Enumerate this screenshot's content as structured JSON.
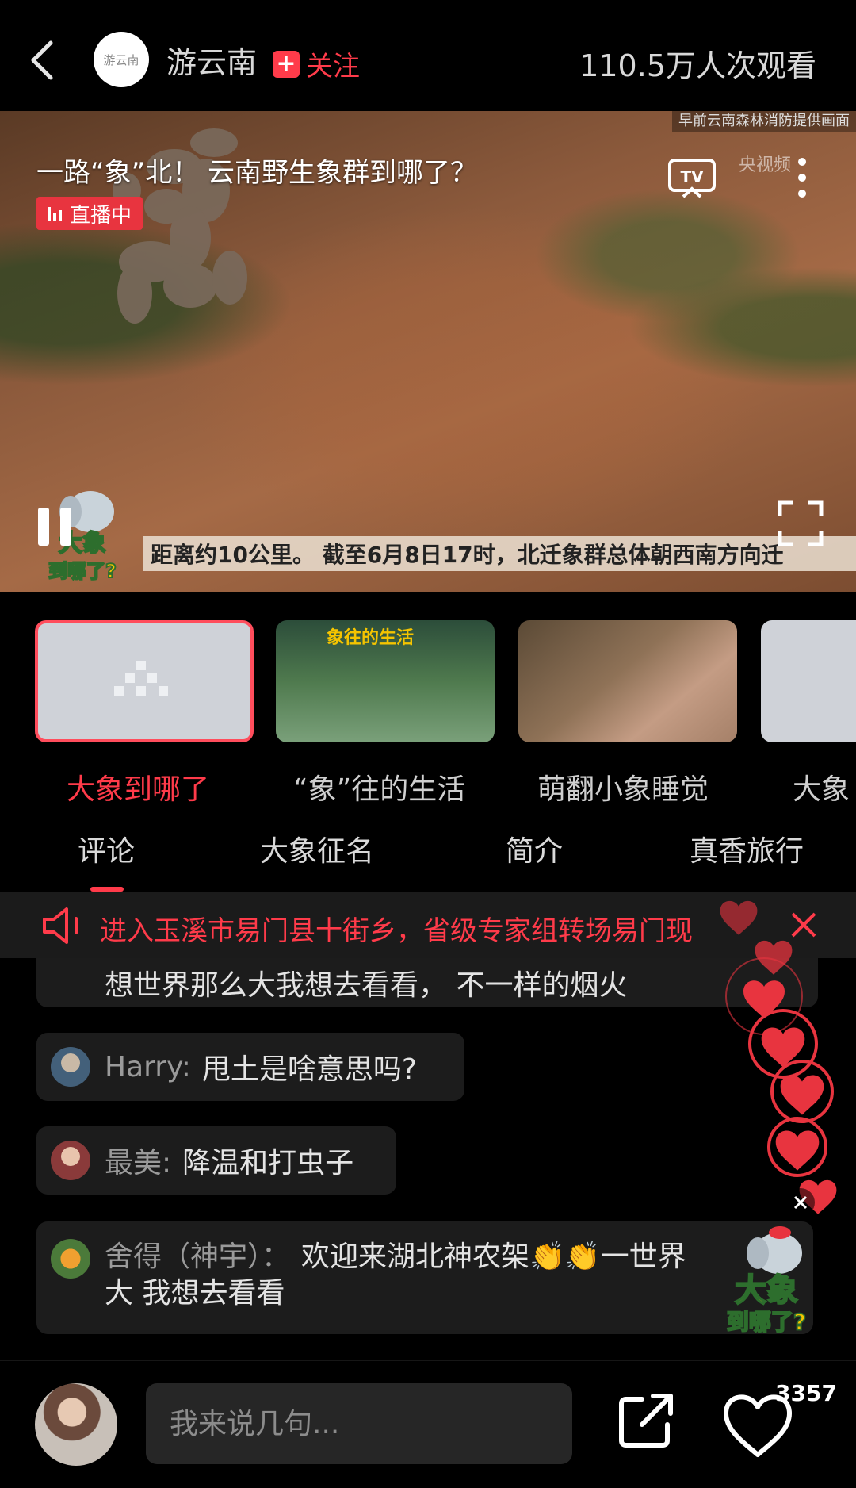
{
  "header": {
    "logo_text": "游云南",
    "channel_name": "游云南",
    "follow_label": "关注",
    "viewers": "110.5万人次观看"
  },
  "video": {
    "title": "一路“象”北！ 云南野生象群到哪了？",
    "live_label": "直播中",
    "source_note": "早前云南森林消防提供画面",
    "watermark": "央视频",
    "subtitle": "距离约10公里。 截至6月8日17时，北迁象群总体朝西南方向迁",
    "mascot_text": "大象到哪了?"
  },
  "playlist": [
    {
      "label": "大象到哪了",
      "selected": true
    },
    {
      "label": "“象”往的生活",
      "selected": false,
      "overlay": "象往的生活"
    },
    {
      "label": "萌翻小象睡觉",
      "selected": false
    },
    {
      "label": "大象",
      "selected": false
    }
  ],
  "tabs": [
    "评论",
    "大象征名",
    "简介",
    "真香旅行"
  ],
  "announcement": "进入玉溪市易门县十街乡，省级专家组转场易门现",
  "comments": [
    {
      "user": "",
      "text": "想世界那么大我想去看看， 不一样的烟火"
    },
    {
      "user": "Harry:",
      "text": "甩土是啥意思吗?"
    },
    {
      "user": "最美:",
      "text": "降温和打虫子"
    },
    {
      "user": "舍得（神宇）：",
      "text": "欢迎来湖北神农架👏👏一世界",
      "text2": "大 我想去看看"
    }
  ],
  "bottom": {
    "input_placeholder": "我来说几句...",
    "like_count": "3357",
    "mascot_text": "大象到哪了?"
  },
  "colors": {
    "accent": "#ff3b4a",
    "background": "#000000",
    "bubble": "#1c1c1c"
  }
}
